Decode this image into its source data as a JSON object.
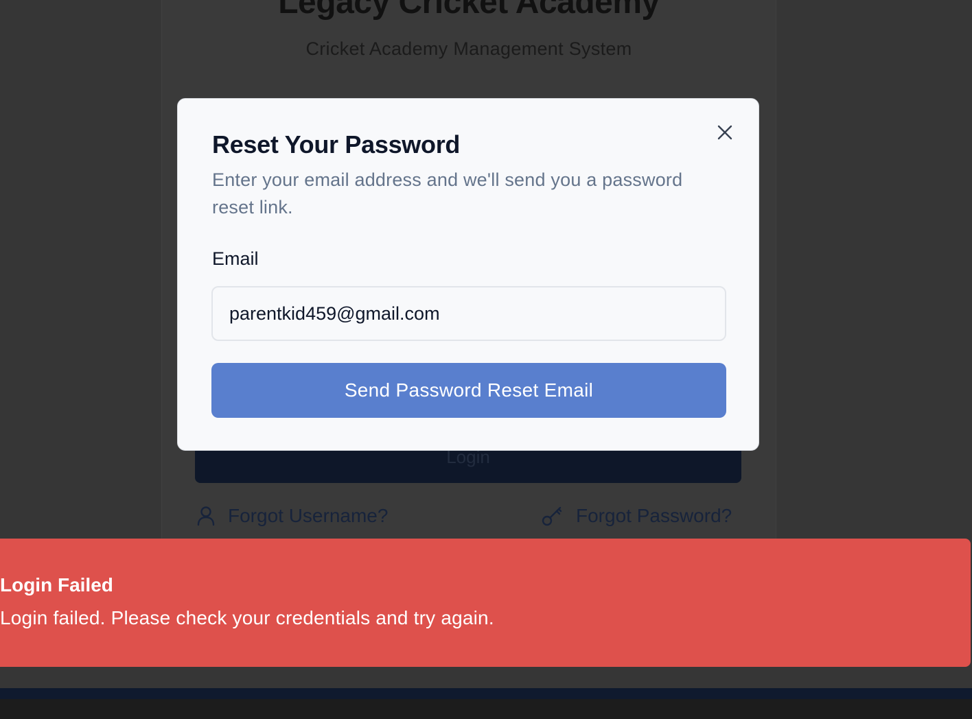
{
  "background_page": {
    "title": "Legacy Cricket Academy",
    "subtitle": "Cricket Academy Management System",
    "login_button": "Login",
    "forgot_username": "Forgot Username?",
    "forgot_password": "Forgot Password?"
  },
  "modal": {
    "title": "Reset Your Password",
    "description": "Enter your email address and we'll send you a password reset link.",
    "email_label": "Email",
    "email_value": "parentkid459@gmail.com",
    "submit_label": "Send Password Reset Email",
    "close_icon": "close-icon"
  },
  "toast": {
    "title": "Login Failed",
    "message": "Login failed. Please check your credentials and try again."
  },
  "colors": {
    "primary_button": "#597fce",
    "error_toast": "#de514c",
    "overlay": "#363636",
    "login_button": "#0e1729"
  },
  "icons": {
    "user": "user-icon",
    "key": "key-icon"
  }
}
